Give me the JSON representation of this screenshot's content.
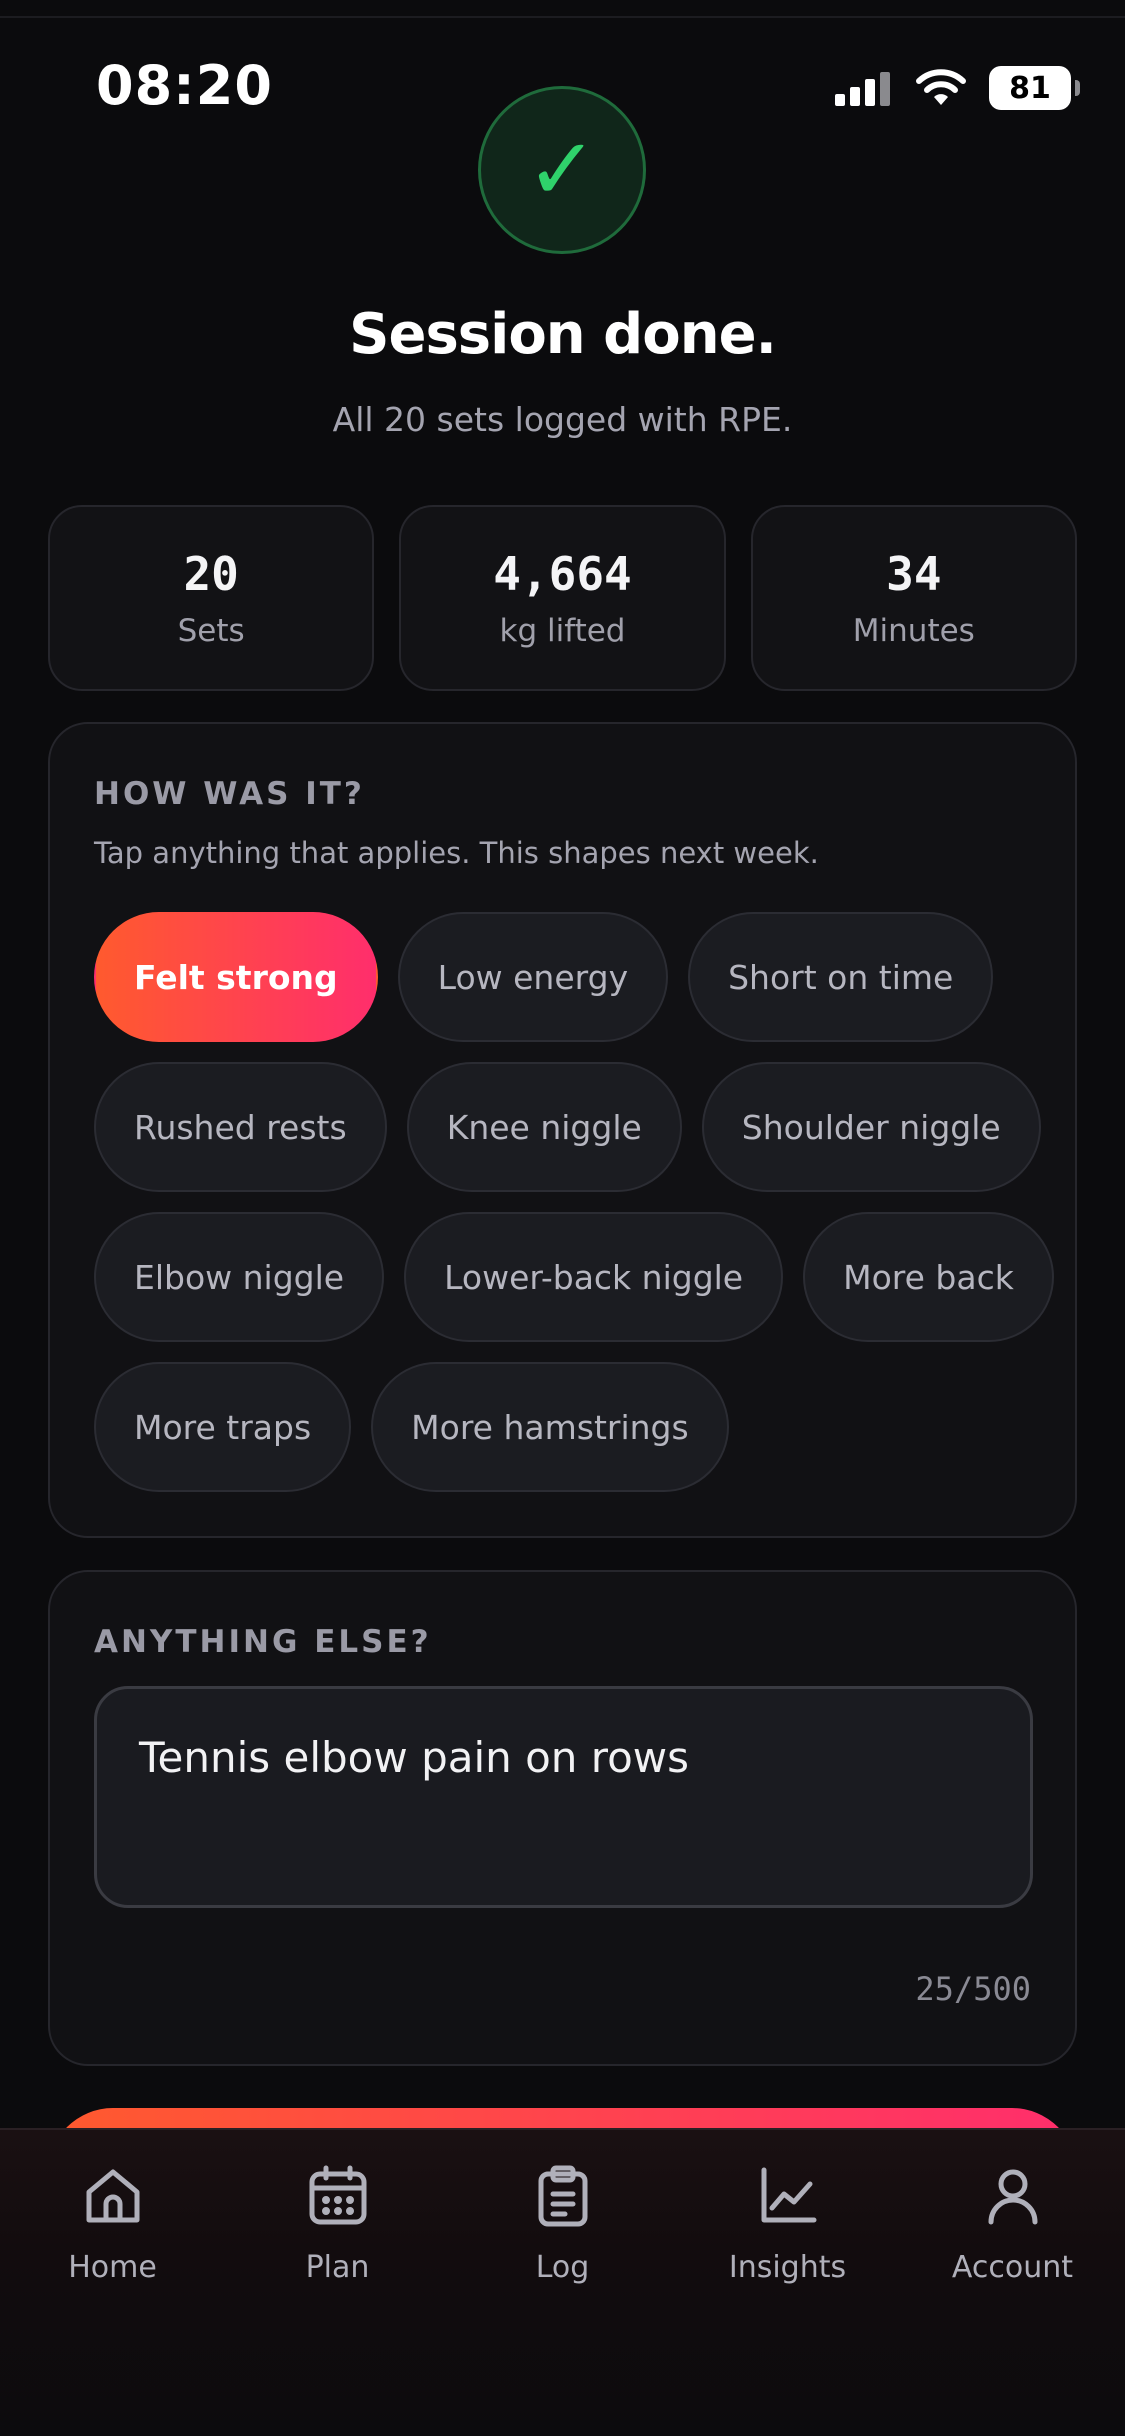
{
  "status": {
    "time": "08:20",
    "battery": "81"
  },
  "header": {
    "title": "Session done.",
    "subtitle": "All 20 sets logged with RPE."
  },
  "stats": [
    {
      "value": "20",
      "label": "Sets"
    },
    {
      "value": "4,664",
      "label": "kg lifted"
    },
    {
      "value": "34",
      "label": "Minutes"
    }
  ],
  "how": {
    "heading": "HOW WAS IT?",
    "help": "Tap anything that applies. This shapes next week.",
    "chips": [
      {
        "label": "Felt strong",
        "selected": true
      },
      {
        "label": "Low energy",
        "selected": false
      },
      {
        "label": "Short on time",
        "selected": false
      },
      {
        "label": "Rushed rests",
        "selected": false
      },
      {
        "label": "Knee niggle",
        "selected": false
      },
      {
        "label": "Shoulder niggle",
        "selected": false
      },
      {
        "label": "Elbow niggle",
        "selected": false
      },
      {
        "label": "Lower-back niggle",
        "selected": false
      },
      {
        "label": "More back",
        "selected": false
      },
      {
        "label": "More traps",
        "selected": false
      },
      {
        "label": "More hamstrings",
        "selected": false
      }
    ]
  },
  "notes": {
    "heading": "ANYTHING ELSE?",
    "value": "Tennis elbow pain on rows",
    "counter": "25/500"
  },
  "tabs": [
    {
      "label": "Home",
      "icon": "home-icon"
    },
    {
      "label": "Plan",
      "icon": "calendar-icon"
    },
    {
      "label": "Log",
      "icon": "clipboard-icon"
    },
    {
      "label": "Insights",
      "icon": "chart-icon"
    },
    {
      "label": "Account",
      "icon": "user-icon"
    }
  ],
  "colors": {
    "accent_start": "#ff5a2e",
    "accent_end": "#ff2e6c",
    "success": "#2fd26b",
    "background": "#0b0b0d"
  }
}
